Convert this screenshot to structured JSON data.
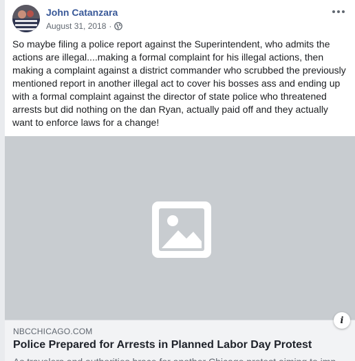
{
  "post": {
    "author": "John Catanzara",
    "date": "August 31, 2018",
    "separator": "·",
    "privacy_icon": "globe-icon",
    "more_icon": "more-options-icon",
    "text": "So maybe filing a police report against the Superintendent, who admits the actions are illegal....making a formal complaint for his illegal actions, then making a complaint against a district commander who scrubbed the previously mentioned report in another illegal act to cover his bosses ass and ending up with a formal complaint against the director of state police who threatened arrests but did nothing on the dan Ryan, actually paid off and they actually want to enforce laws for a change!"
  },
  "link_preview": {
    "image_icon": "image-placeholder-icon",
    "domain": "NBCCHICAGO.COM",
    "title": "Police Prepared for Arrests in Planned Labor Day Protest",
    "description": "As travelers and authorities brace for another Chicago protest aiming to imp",
    "info_label": "i"
  },
  "colors": {
    "author": "#385898",
    "page_bg": "#e9ebee",
    "image_bg": "#c8ccd0",
    "footer_bg": "#f2f3f5"
  }
}
